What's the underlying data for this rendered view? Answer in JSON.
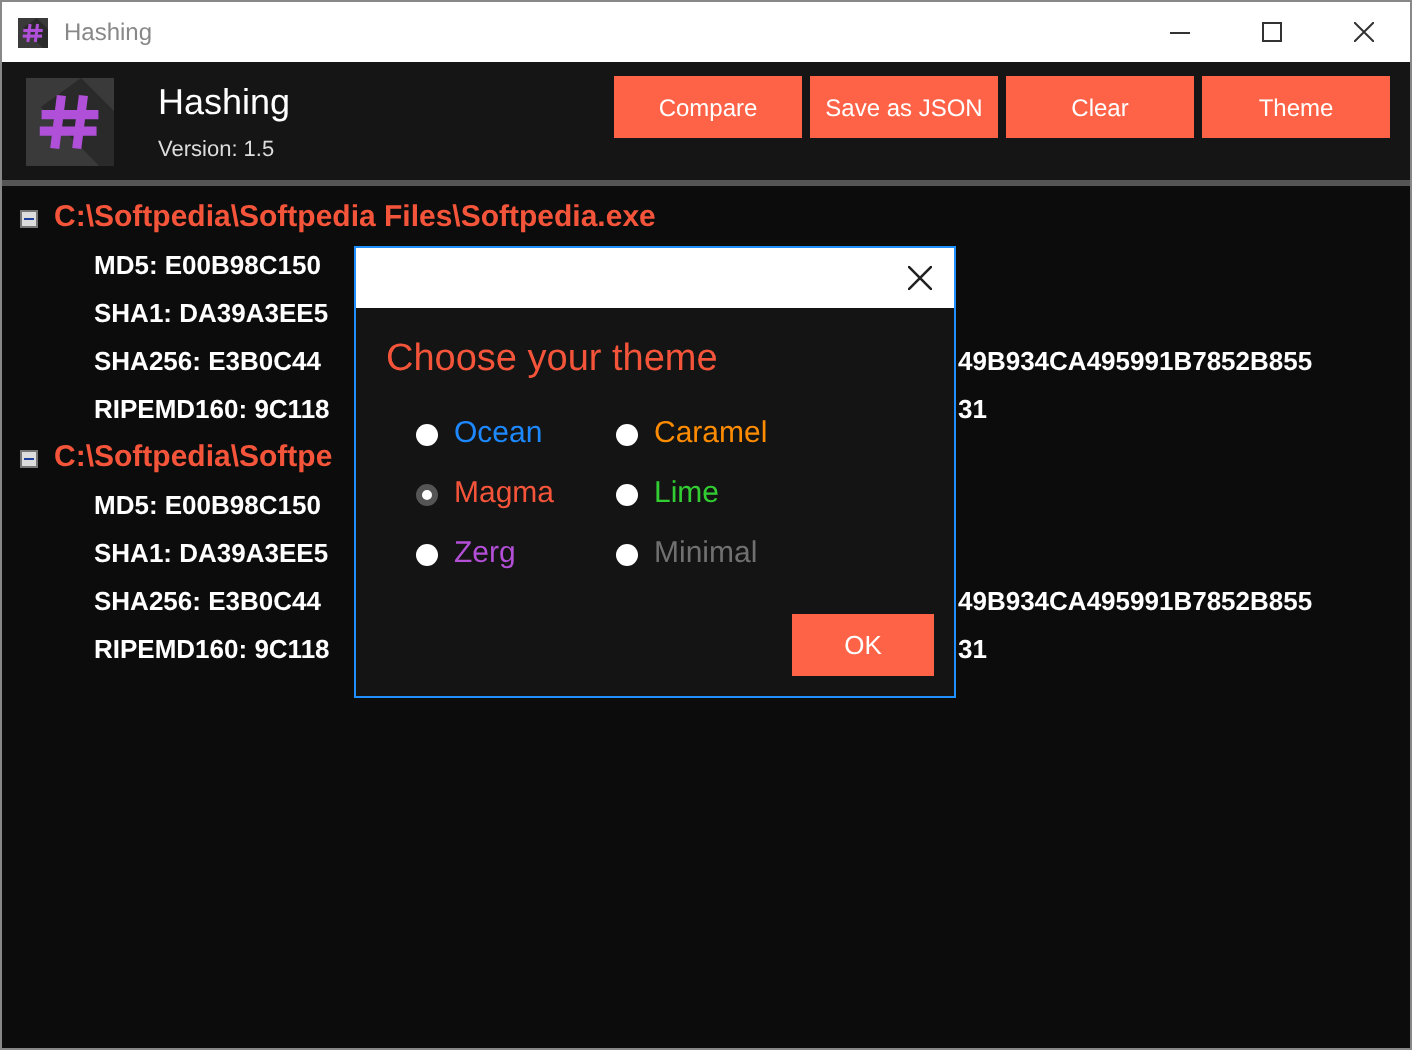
{
  "window": {
    "title": "Hashing"
  },
  "header": {
    "title": "Hashing",
    "version": "Version: 1.5",
    "buttons": [
      "Compare",
      "Save as JSON",
      "Clear",
      "Theme"
    ]
  },
  "tree": [
    {
      "label": "C:\\Softpedia\\Softpedia Files\\Softpedia.exe",
      "expanded": true,
      "children": [
        {
          "text": "MD5: E00B98C150"
        },
        {
          "text": "SHA1: DA39A3EE5"
        },
        {
          "text": "SHA256: E3B0C44",
          "tail": "49B934CA495991B7852B855"
        },
        {
          "text": "RIPEMD160: 9C118",
          "tail": "31"
        }
      ]
    },
    {
      "label": "C:\\Softpedia\\Softpe",
      "expanded": true,
      "children": [
        {
          "text": "MD5: E00B98C150"
        },
        {
          "text": "SHA1: DA39A3EE5"
        },
        {
          "text": "SHA256: E3B0C44",
          "tail": "49B934CA495991B7852B855"
        },
        {
          "text": "RIPEMD160: 9C118",
          "tail": "31"
        }
      ]
    }
  ],
  "dialog": {
    "heading": "Choose your theme",
    "themes": [
      {
        "name": "Ocean",
        "color": "#1e88ff",
        "selected": false
      },
      {
        "name": "Caramel",
        "color": "#ff8c00",
        "selected": false
      },
      {
        "name": "Magma",
        "color": "#f4553a",
        "selected": true
      },
      {
        "name": "Lime",
        "color": "#32cd32",
        "selected": false
      },
      {
        "name": "Zerg",
        "color": "#b34fd6",
        "selected": false
      },
      {
        "name": "Minimal",
        "color": "#707070",
        "selected": false
      }
    ],
    "ok": "OK"
  }
}
